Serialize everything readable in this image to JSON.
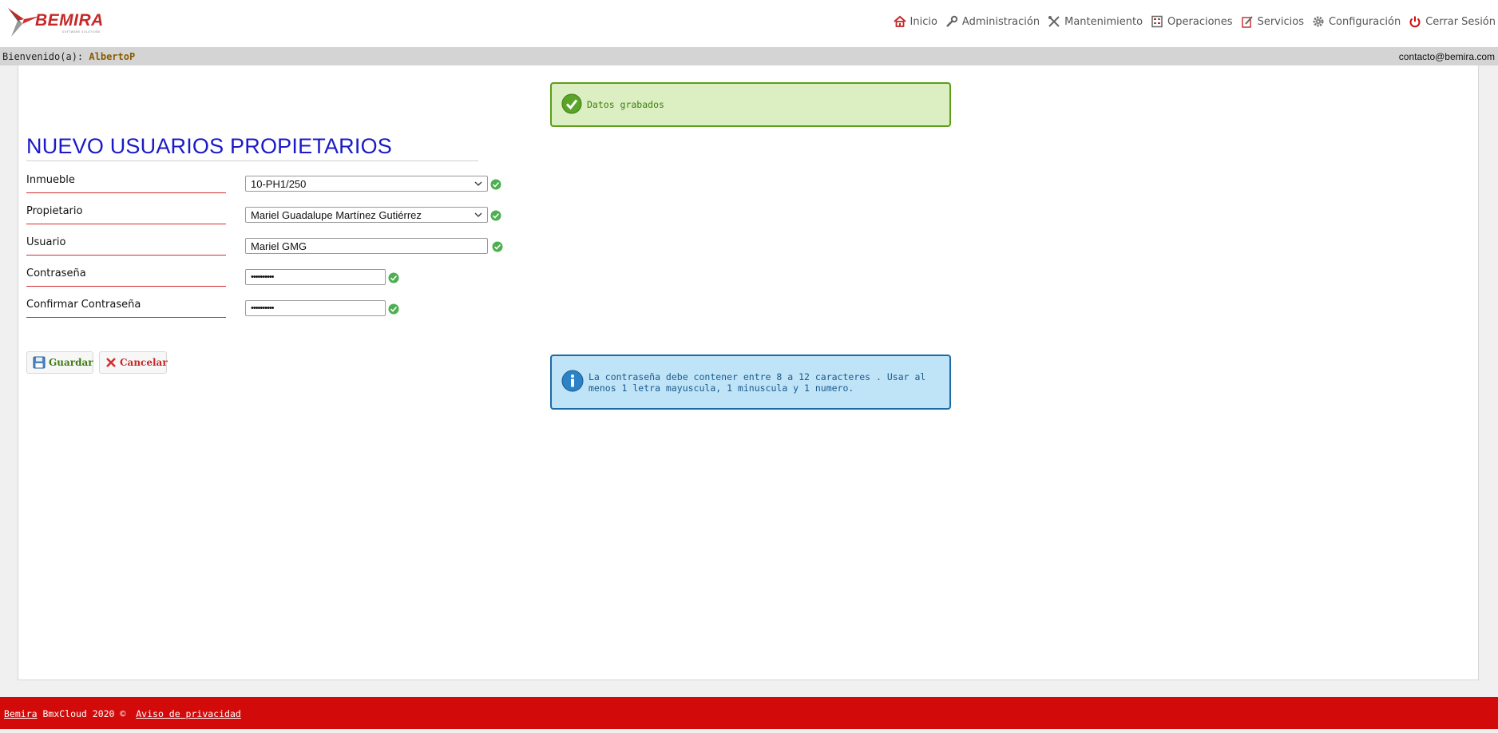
{
  "brand": {
    "name": "BEMIRA",
    "tagline": "SOFTWARE SOLUTIONS"
  },
  "nav": [
    {
      "label": "Inicio",
      "icon": "home-icon"
    },
    {
      "label": "Administración",
      "icon": "wrench-icon"
    },
    {
      "label": "Mantenimiento",
      "icon": "tools-icon"
    },
    {
      "label": "Operaciones",
      "icon": "calculator-icon"
    },
    {
      "label": "Servicios",
      "icon": "edit-document-icon"
    },
    {
      "label": "Configuración",
      "icon": "gear-icon"
    },
    {
      "label": "Cerrar Sesión",
      "icon": "power-icon"
    }
  ],
  "welcome": {
    "prefix": "Bienvenido(a):",
    "user": "AlbertoP",
    "contact": "contacto@bemira.com"
  },
  "messages": {
    "success": "Datos grabados",
    "info": "La contraseña debe contener entre 8 a 12 caracteres . Usar al menos 1 letra mayuscula, 1 minuscula y 1 numero."
  },
  "page_title": "NUEVO USUARIOS PROPIETARIOS",
  "form": {
    "inmueble": {
      "label": "Inmueble",
      "value": "10-PH1/250"
    },
    "propietario": {
      "label": "Propietario",
      "value": "Mariel Guadalupe Martínez Gutiérrez"
    },
    "usuario": {
      "label": "Usuario",
      "value": "Mariel GMG"
    },
    "contrasena": {
      "label": "Contraseña",
      "value": "••••••••••"
    },
    "confirmar": {
      "label": "Confirmar Contraseña",
      "value": "••••••••••"
    }
  },
  "buttons": {
    "save": "Guardar",
    "cancel": "Cancelar"
  },
  "footer": {
    "brand": "Bemira",
    "copyright": " BmxCloud 2020 © ",
    "privacy": "Aviso de privacidad"
  },
  "colors": {
    "accent_red": "#d30a0a",
    "title_blue": "#1a1ac8",
    "success_green": "#5c9e1a",
    "info_blue": "#1d6aa5"
  }
}
